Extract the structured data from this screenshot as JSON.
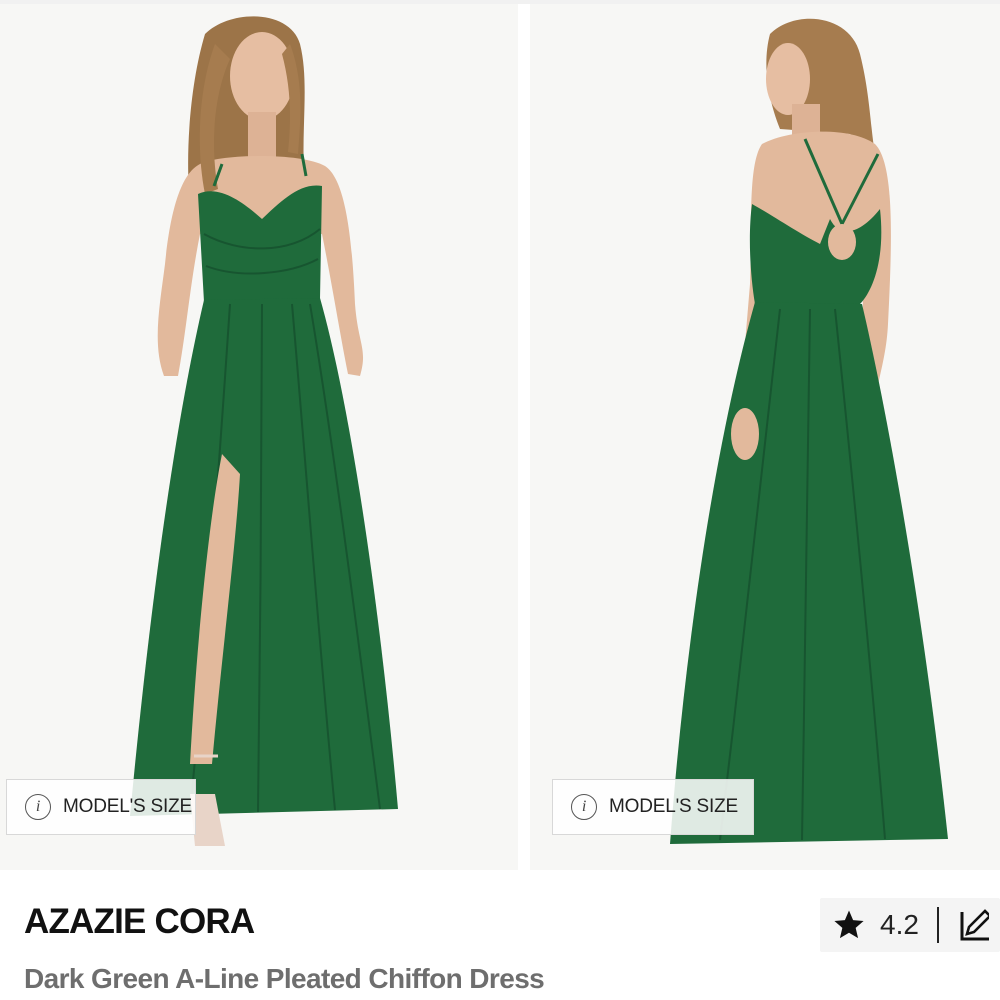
{
  "gallery": {
    "photos": [
      {
        "view": "front",
        "badge_label": "MODEL'S SIZE"
      },
      {
        "view": "back",
        "badge_label": "MODEL'S SIZE"
      }
    ]
  },
  "product": {
    "brand_title": "AZAZIE CORA",
    "name": "Dark Green A-Line Pleated Chiffon Dress",
    "rating": "4.2"
  },
  "icons": {
    "info": "info-icon",
    "star": "star-icon",
    "edit": "edit-icon"
  },
  "colors": {
    "dress": "#1f6b3b",
    "dress_shadow": "#175530",
    "skin": "#e2b99c",
    "hair": "#9c7448",
    "text_primary": "#111111",
    "text_secondary": "#6e6e6e"
  }
}
